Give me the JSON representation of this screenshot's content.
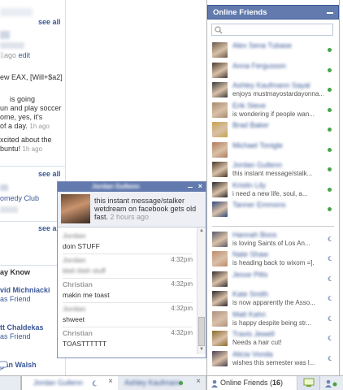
{
  "feed": {
    "see_all": "see all",
    "fragments": [
      {
        "text": "ago",
        "gray": true
      },
      {
        "text": "edit",
        "link": true
      },
      {
        "text": "ew EAX, [Will+$a2]"
      },
      {
        "text": "is going"
      },
      {
        "text": "un and play soccer"
      },
      {
        "text": "ome, yes, it's"
      },
      {
        "text": "of a day.",
        "time": "1h ago"
      },
      {
        "text": "xcited about the"
      },
      {
        "text": "buntu!",
        "time": "1h ago"
      }
    ],
    "comedy": "omedy Club",
    "may_know": "ay Know",
    "people": [
      {
        "name": "vid Michniacki",
        "action": "as Friend"
      },
      {
        "name": "tt Chaldekas",
        "action": "as Friend"
      },
      {
        "name": "gan Walsh",
        "action": ""
      }
    ]
  },
  "online_friends": {
    "title": "Online Friends",
    "search_placeholder": "",
    "friends": [
      {
        "name": "Alex Sena Tubase",
        "status": "",
        "state": "online",
        "color": "#6b5a4a"
      },
      {
        "name": "Anna Fergusson",
        "status": "",
        "state": "online",
        "color": "#4a3a33"
      },
      {
        "name": "Ashley Kaufmann Sayal",
        "status": "enjoys mustmayostardayonna...",
        "state": "online",
        "color": "#3c3c3c"
      },
      {
        "name": "Erik Steve",
        "status": "is wondering if people wan...",
        "state": "online",
        "color": "#a58a6a"
      },
      {
        "name": "Brad Baker",
        "status": "",
        "state": "online",
        "color": "#c7a24a"
      },
      {
        "name": "Michael Tonigle",
        "status": "",
        "state": "online",
        "color": "#b07a5a"
      },
      {
        "name": "Jordan Gullenn",
        "status": "this instant message/stalk...",
        "state": "online",
        "color": "#4a3a2a"
      },
      {
        "name": "Kristin Lily",
        "status": "i need a new life, soul, a...",
        "state": "online",
        "color": "#2a2a2a"
      },
      {
        "name": "Tanner Emmons",
        "status": "",
        "state": "online",
        "color": "#304a7a"
      },
      {
        "name": "Hannah Boos",
        "status": "is loving Saints of Los An...",
        "state": "idle",
        "color": "#5a5a6a"
      },
      {
        "name": "Nate Shaw",
        "status": "is heading back to wixom =].",
        "state": "idle",
        "color": "#c08a6a"
      },
      {
        "name": "Jesse Pitts",
        "status": "",
        "state": "idle",
        "color": "#3a3030"
      },
      {
        "name": "Kate Smith",
        "status": "is now apparently the Asso...",
        "state": "idle",
        "color": "#2e2a2a"
      },
      {
        "name": "Matt Kahn",
        "status": "is happy despite being str...",
        "state": "idle",
        "color": "#b09080"
      },
      {
        "name": "Travis Jewell",
        "status": "Needs a hair cut!",
        "state": "idle",
        "color": "#8a6a2a"
      },
      {
        "name": "Alicia Vonda",
        "status": "wishes this semester was l...",
        "state": "idle",
        "color": "#4a4050"
      }
    ],
    "colors": {
      "header": "#627aad",
      "online": "#47a447"
    }
  },
  "chat": {
    "name": "Jordan Gullenn",
    "close": "×",
    "status": "this instant message/stalker wetdream on facebook gets old fast.",
    "status_time": "2 hours ago",
    "messages": [
      {
        "sender": "Jordan",
        "time": "",
        "text": "doin STUFF",
        "blurred_sender": true
      },
      {
        "sender": "Jordan",
        "time": "4:32pm",
        "text": "blah blah stuff",
        "blurred_sender": true,
        "blurred_text": true
      },
      {
        "sender": "Christian",
        "time": "4:32pm",
        "text": "makin me toast"
      },
      {
        "sender": "Jordan",
        "time": "4:32pm",
        "text": "shweet",
        "blurred_sender": true
      },
      {
        "sender": "Christian",
        "time": "4:32pm",
        "text": "TOASTTTTTT"
      }
    ]
  },
  "chatbar": {
    "active_tab_name": "Jordan Gullenn",
    "second_tab_name": "Ashley Kaufmann",
    "close": "×",
    "friends_label": "Online Friends",
    "friends_count": "16"
  }
}
